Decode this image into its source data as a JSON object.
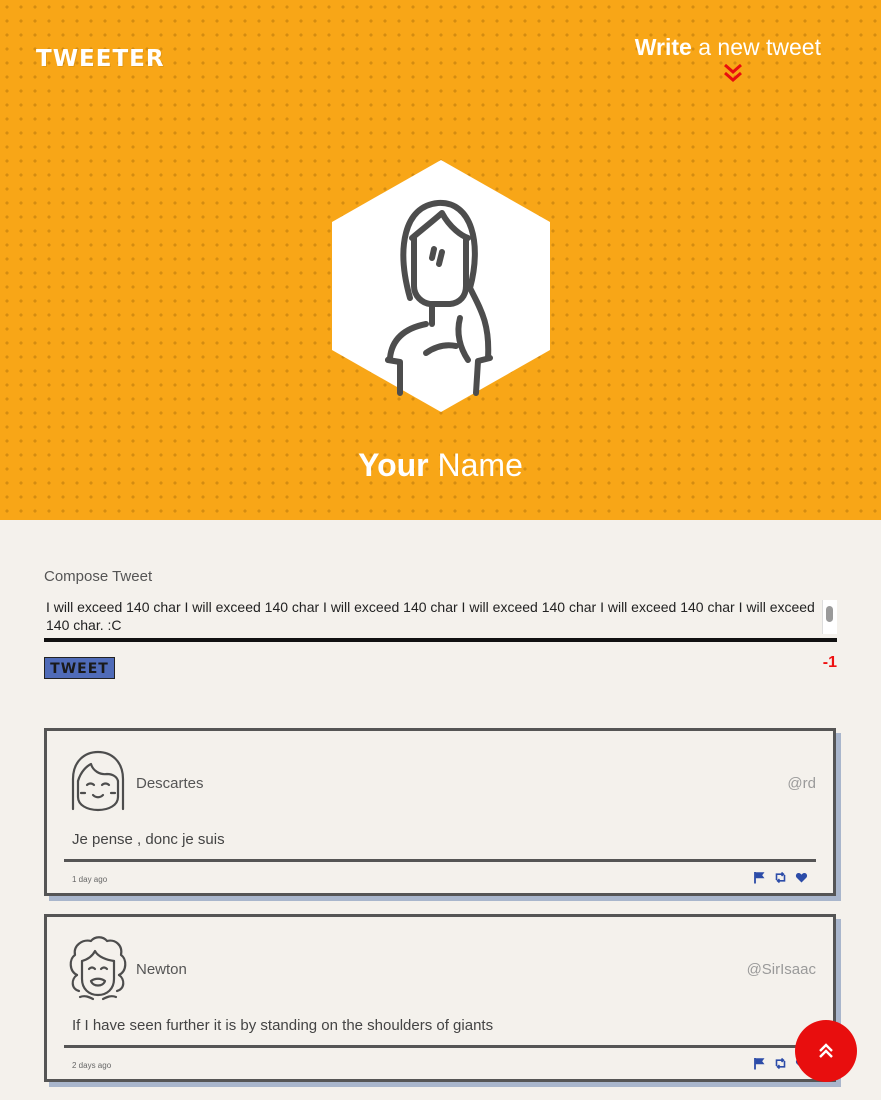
{
  "header": {
    "logo": "TWEETER",
    "write_bold": "Write",
    "write_rest": " a new tweet",
    "colors": {
      "hero": "#f8a617",
      "accent": "#e80e0e"
    }
  },
  "profile": {
    "name_bold": "Your",
    "name_rest": " Name",
    "avatar_icon": "girl-avatar-icon"
  },
  "compose": {
    "label": "Compose Tweet",
    "text": "I will exceed 140 char I will exceed 140 char I will exceed 140 char I will exceed 140 char I will exceed 140 char I will exceed 140 char. :C",
    "button": "TWEET",
    "counter": "-1"
  },
  "tweets": [
    {
      "author": "Descartes",
      "handle": "@rd",
      "text": "Je pense , donc je suis",
      "time": "1 day ago",
      "avatar_icon": "descartes-avatar-icon"
    },
    {
      "author": "Newton",
      "handle": "@SirIsaac",
      "text": "If I have seen further it is by standing on the shoulders of giants",
      "time": "2 days ago",
      "avatar_icon": "newton-avatar-icon"
    }
  ],
  "action_icons": [
    "flag-icon",
    "retweet-icon",
    "heart-icon"
  ],
  "scroll_top_icon": "double-chevron-up-icon"
}
